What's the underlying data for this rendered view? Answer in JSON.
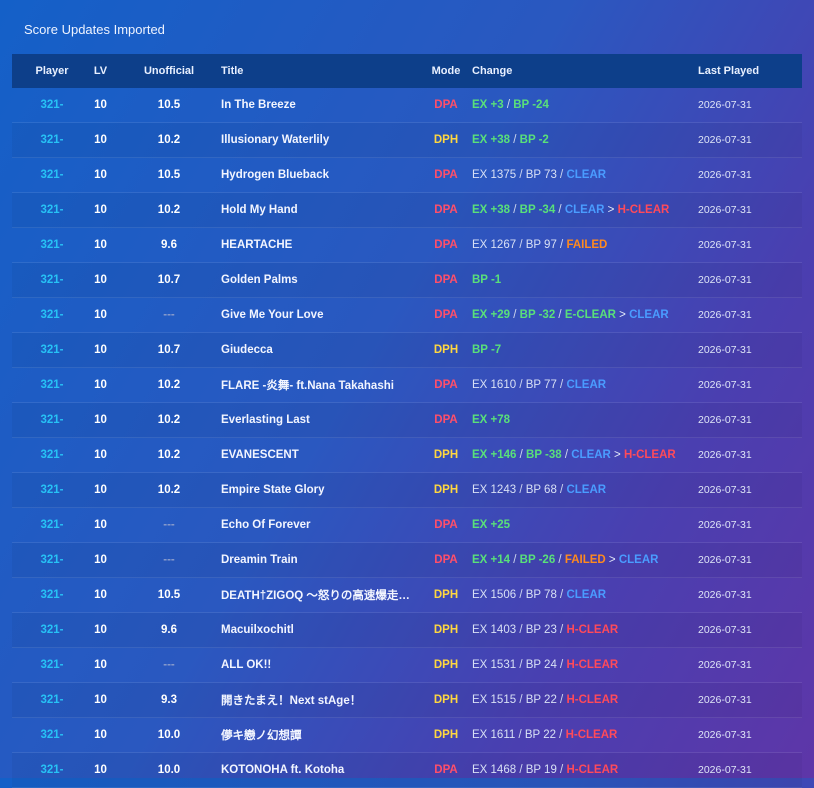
{
  "page": {
    "title": "Score Updates Imported"
  },
  "columns": {
    "player": "Player",
    "lv": "LV",
    "unofficial": "Unofficial",
    "title": "Title",
    "mode": "Mode",
    "change": "Change",
    "last_played": "Last Played"
  },
  "colors": {
    "DPA": "#ff4f6a",
    "DPH": "#ffd740",
    "ex": "#59e07a",
    "bp": "#59e07a",
    "CLEAR": "#4a9cff",
    "H-CLEAR": "#ff4a5a",
    "E-CLEAR": "#59e07a",
    "FAILED": "#ff8a1e",
    "plain": "#d8e0f5",
    "player": "#27c2f5"
  },
  "rows": [
    {
      "player": "321-",
      "lv": "10",
      "unofficial": "10.5",
      "title": "In The Breeze",
      "mode": "DPA",
      "date": "2026-07-31",
      "change": [
        {
          "t": "EX +3",
          "k": "ex"
        },
        {
          "t": "BP -24",
          "k": "bp"
        }
      ]
    },
    {
      "player": "321-",
      "lv": "10",
      "unofficial": "10.2",
      "title": "Illusionary Waterlily",
      "mode": "DPH",
      "date": "2026-07-31",
      "change": [
        {
          "t": "EX +38",
          "k": "ex"
        },
        {
          "t": "BP -2",
          "k": "bp"
        }
      ]
    },
    {
      "player": "321-",
      "lv": "10",
      "unofficial": "10.5",
      "title": "Hydrogen Blueback",
      "mode": "DPA",
      "date": "2026-07-31",
      "change": [
        {
          "t": "EX 1375",
          "k": "plain"
        },
        {
          "t": "BP 73",
          "k": "plain"
        },
        {
          "t": "CLEAR",
          "k": "CLEAR"
        }
      ]
    },
    {
      "player": "321-",
      "lv": "10",
      "unofficial": "10.2",
      "title": "Hold My Hand",
      "mode": "DPA",
      "date": "2026-07-31",
      "change": [
        {
          "t": "EX +38",
          "k": "ex"
        },
        {
          "t": "BP -34",
          "k": "bp"
        },
        {
          "t": "CLEAR",
          "k": "CLEAR",
          "to": {
            "t": "H-CLEAR",
            "k": "H-CLEAR"
          }
        }
      ]
    },
    {
      "player": "321-",
      "lv": "10",
      "unofficial": "9.6",
      "title": "HEARTACHE",
      "mode": "DPA",
      "date": "2026-07-31",
      "change": [
        {
          "t": "EX 1267",
          "k": "plain"
        },
        {
          "t": "BP 97",
          "k": "plain"
        },
        {
          "t": "FAILED",
          "k": "FAILED"
        }
      ]
    },
    {
      "player": "321-",
      "lv": "10",
      "unofficial": "10.7",
      "title": "Golden Palms",
      "mode": "DPA",
      "date": "2026-07-31",
      "change": [
        {
          "t": "BP -1",
          "k": "bp"
        }
      ]
    },
    {
      "player": "321-",
      "lv": "10",
      "unofficial": "---",
      "title": "Give Me Your Love",
      "mode": "DPA",
      "date": "2026-07-31",
      "change": [
        {
          "t": "EX +29",
          "k": "ex"
        },
        {
          "t": "BP -32",
          "k": "bp"
        },
        {
          "t": "E-CLEAR",
          "k": "E-CLEAR",
          "to": {
            "t": "CLEAR",
            "k": "CLEAR"
          }
        }
      ]
    },
    {
      "player": "321-",
      "lv": "10",
      "unofficial": "10.7",
      "title": "Giudecca",
      "mode": "DPH",
      "date": "2026-07-31",
      "change": [
        {
          "t": "BP -7",
          "k": "bp"
        }
      ]
    },
    {
      "player": "321-",
      "lv": "10",
      "unofficial": "10.2",
      "title": "FLARE -炎舞- ft.Nana Takahashi",
      "mode": "DPA",
      "date": "2026-07-31",
      "change": [
        {
          "t": "EX 1610",
          "k": "plain"
        },
        {
          "t": "BP 77",
          "k": "plain"
        },
        {
          "t": "CLEAR",
          "k": "CLEAR"
        }
      ]
    },
    {
      "player": "321-",
      "lv": "10",
      "unofficial": "10.2",
      "title": "Everlasting Last",
      "mode": "DPA",
      "date": "2026-07-31",
      "change": [
        {
          "t": "EX +78",
          "k": "ex"
        }
      ]
    },
    {
      "player": "321-",
      "lv": "10",
      "unofficial": "10.2",
      "title": "EVANESCENT",
      "mode": "DPH",
      "date": "2026-07-31",
      "change": [
        {
          "t": "EX +146",
          "k": "ex"
        },
        {
          "t": "BP -38",
          "k": "bp"
        },
        {
          "t": "CLEAR",
          "k": "CLEAR",
          "to": {
            "t": "H-CLEAR",
            "k": "H-CLEAR"
          }
        }
      ]
    },
    {
      "player": "321-",
      "lv": "10",
      "unofficial": "10.2",
      "title": "Empire State Glory",
      "mode": "DPH",
      "date": "2026-07-31",
      "change": [
        {
          "t": "EX 1243",
          "k": "plain"
        },
        {
          "t": "BP 68",
          "k": "plain"
        },
        {
          "t": "CLEAR",
          "k": "CLEAR"
        }
      ]
    },
    {
      "player": "321-",
      "lv": "10",
      "unofficial": "---",
      "title": "Echo Of Forever",
      "mode": "DPA",
      "date": "2026-07-31",
      "change": [
        {
          "t": "EX +25",
          "k": "ex"
        }
      ]
    },
    {
      "player": "321-",
      "lv": "10",
      "unofficial": "---",
      "title": "Dreamin Train",
      "mode": "DPA",
      "date": "2026-07-31",
      "change": [
        {
          "t": "EX +14",
          "k": "ex"
        },
        {
          "t": "BP -26",
          "k": "bp"
        },
        {
          "t": "FAILED",
          "k": "FAILED",
          "to": {
            "t": "CLEAR",
            "k": "CLEAR"
          }
        }
      ]
    },
    {
      "player": "321-",
      "lv": "10",
      "unofficial": "10.5",
      "title": "DEATH†ZIGOQ ～怒りの高速爆走野郎～",
      "mode": "DPH",
      "date": "2026-07-31",
      "change": [
        {
          "t": "EX 1506",
          "k": "plain"
        },
        {
          "t": "BP 78",
          "k": "plain"
        },
        {
          "t": "CLEAR",
          "k": "CLEAR"
        }
      ]
    },
    {
      "player": "321-",
      "lv": "10",
      "unofficial": "9.6",
      "title": "Macuilxochitl",
      "mode": "DPH",
      "date": "2026-07-31",
      "change": [
        {
          "t": "EX 1403",
          "k": "plain"
        },
        {
          "t": "BP 23",
          "k": "plain"
        },
        {
          "t": "H-CLEAR",
          "k": "H-CLEAR"
        }
      ]
    },
    {
      "player": "321-",
      "lv": "10",
      "unofficial": "---",
      "title": "ALL OK!!",
      "mode": "DPH",
      "date": "2026-07-31",
      "change": [
        {
          "t": "EX 1531",
          "k": "plain"
        },
        {
          "t": "BP 24",
          "k": "plain"
        },
        {
          "t": "H-CLEAR",
          "k": "H-CLEAR"
        }
      ]
    },
    {
      "player": "321-",
      "lv": "10",
      "unofficial": "9.3",
      "title": "開きたまえ！Next stAge！",
      "mode": "DPH",
      "date": "2026-07-31",
      "change": [
        {
          "t": "EX 1515",
          "k": "plain"
        },
        {
          "t": "BP 22",
          "k": "plain"
        },
        {
          "t": "H-CLEAR",
          "k": "H-CLEAR"
        }
      ]
    },
    {
      "player": "321-",
      "lv": "10",
      "unofficial": "10.0",
      "title": "儚キ戀ノ幻想譚",
      "mode": "DPH",
      "date": "2026-07-31",
      "change": [
        {
          "t": "EX 1611",
          "k": "plain"
        },
        {
          "t": "BP 22",
          "k": "plain"
        },
        {
          "t": "H-CLEAR",
          "k": "H-CLEAR"
        }
      ]
    },
    {
      "player": "321-",
      "lv": "10",
      "unofficial": "10.0",
      "title": "KOTONOHA ft. Kotoha",
      "mode": "DPA",
      "date": "2026-07-31",
      "change": [
        {
          "t": "EX 1468",
          "k": "plain"
        },
        {
          "t": "BP 19",
          "k": "plain"
        },
        {
          "t": "H-CLEAR",
          "k": "H-CLEAR"
        }
      ]
    }
  ]
}
